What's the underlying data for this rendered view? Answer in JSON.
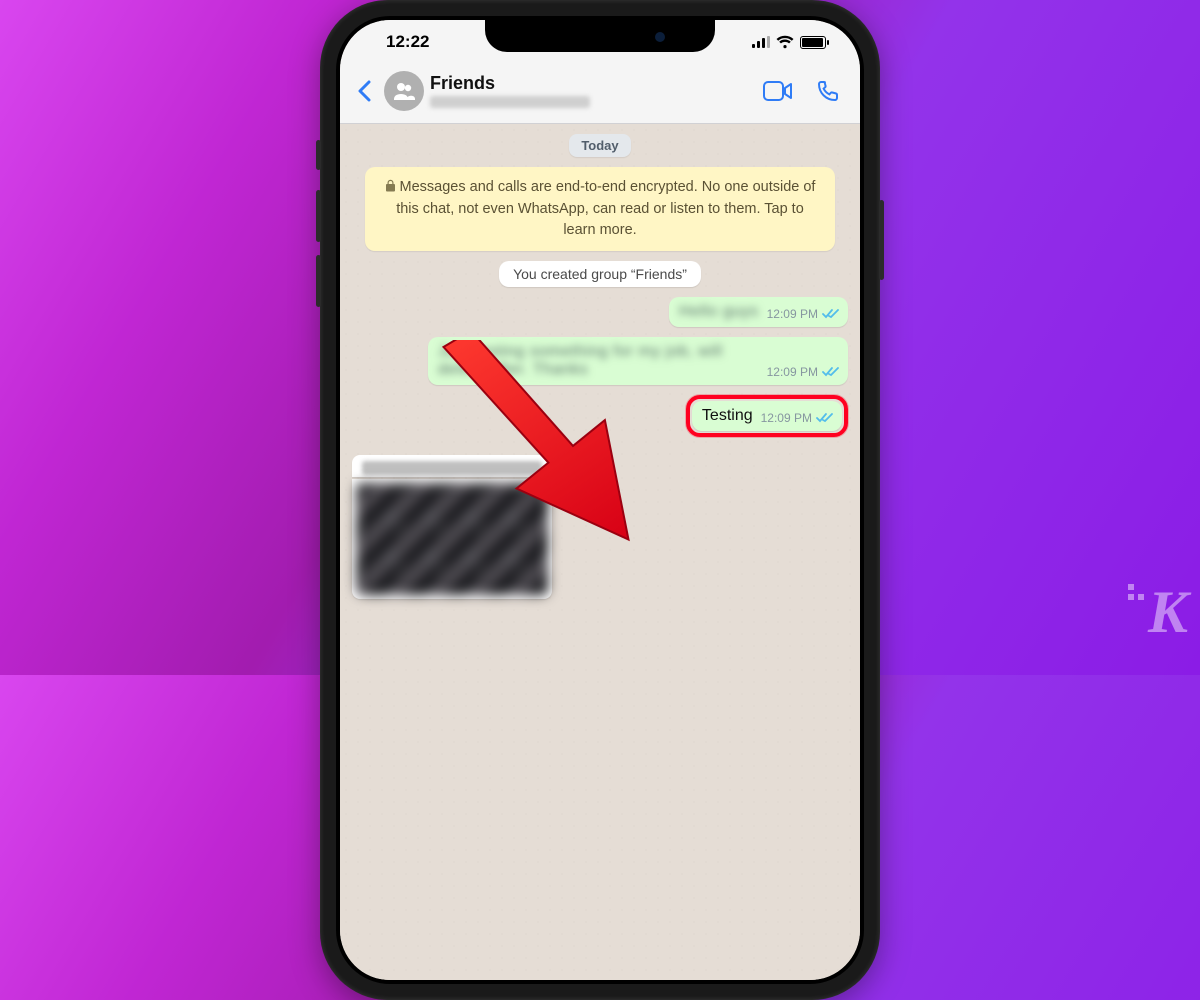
{
  "statusbar": {
    "time": "12:22"
  },
  "nav": {
    "title": "Friends",
    "back_label": "Back",
    "video_label": "Video call",
    "call_label": "Voice call"
  },
  "chat": {
    "day_label": "Today",
    "encryption_notice": "Messages and calls are end-to-end encrypted. No one outside of this chat, not even WhatsApp, can read or listen to them. Tap to learn more.",
    "system_message": "You created group “Friends”",
    "messages": [
      {
        "text": "Hello guys",
        "time": "12:09 PM",
        "redacted": true
      },
      {
        "text": "Just testing something for my job, will delete after. Thanks",
        "time": "12:09 PM",
        "redacted": true
      },
      {
        "text": "Testing",
        "time": "12:09 PM",
        "redacted": false
      }
    ]
  },
  "colors": {
    "ios_blue": "#2f7cf6",
    "outgoing_bubble": "#d9fdd3",
    "tick_read": "#53bdeb",
    "highlight": "#ff0020"
  }
}
